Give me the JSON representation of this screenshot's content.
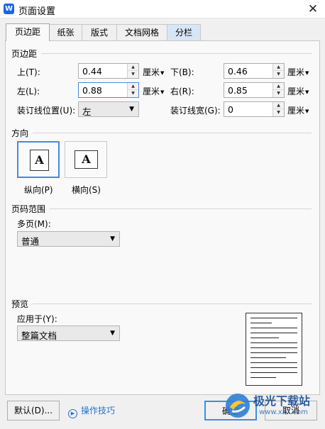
{
  "window": {
    "title": "页面设置",
    "app_icon_text": "W",
    "close": "✕"
  },
  "tabs": [
    {
      "label": "页边距"
    },
    {
      "label": "纸张"
    },
    {
      "label": "版式"
    },
    {
      "label": "文档网格"
    },
    {
      "label": "分栏"
    }
  ],
  "margins": {
    "section": "页边距",
    "top": {
      "label": "上(T):",
      "value": "0.44",
      "unit": "厘米"
    },
    "bottom": {
      "label": "下(B):",
      "value": "0.46",
      "unit": "厘米"
    },
    "left": {
      "label": "左(L):",
      "value": "0.88",
      "unit": "厘米"
    },
    "right": {
      "label": "右(R):",
      "value": "0.85",
      "unit": "厘米"
    },
    "gutter_pos": {
      "label": "装订线位置(U):",
      "value": "左"
    },
    "gutter_width": {
      "label": "装订线宽(G):",
      "value": "0",
      "unit": "厘米"
    }
  },
  "orientation": {
    "section": "方向",
    "portrait": "纵向(P)",
    "landscape": "横向(S)",
    "glyph": "A",
    "selected": "portrait"
  },
  "page_range": {
    "section": "页码范围",
    "label": "多页(M):",
    "value": "普通"
  },
  "preview": {
    "section": "预览",
    "label": "应用于(Y):",
    "value": "整篇文档"
  },
  "footer": {
    "default_button": "默认(D)...",
    "help_link": "操作技巧",
    "ok_button": "确定",
    "cancel_button": "取消"
  },
  "watermark": {
    "text": "极光下载站",
    "url": "www.xz7.com"
  },
  "colors": {
    "accent": "#3b8ee6",
    "link": "#2a73c8",
    "app_icon": "#1c63e8"
  }
}
